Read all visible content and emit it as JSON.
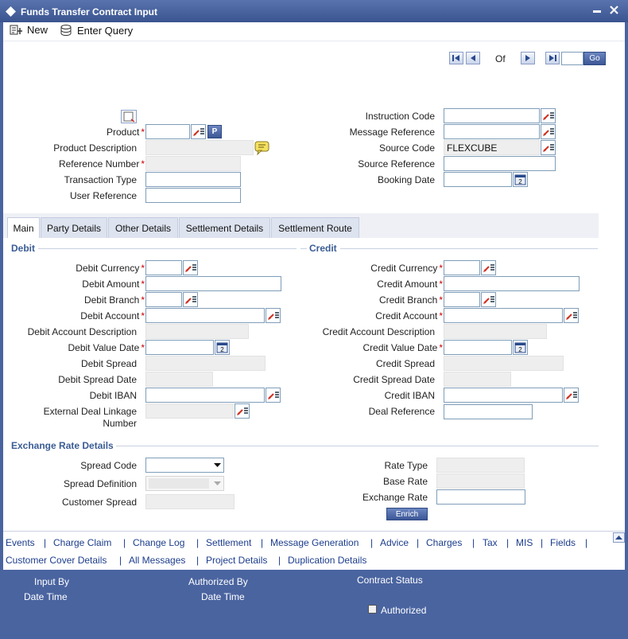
{
  "window": {
    "title": "Funds Transfer Contract Input"
  },
  "toolbar": {
    "new_label": "New",
    "enter_query_label": "Enter Query"
  },
  "pager": {
    "of_label": "Of",
    "go_label": "Go"
  },
  "header": {
    "product_label": "Product",
    "product_btn": "P",
    "product_description_label": "Product Description",
    "reference_number_label": "Reference Number",
    "transaction_type_label": "Transaction Type",
    "user_reference_label": "User Reference",
    "instruction_code_label": "Instruction Code",
    "message_reference_label": "Message Reference",
    "source_code_label": "Source Code",
    "source_code_value": "FLEXCUBE",
    "source_reference_label": "Source Reference",
    "booking_date_label": "Booking Date"
  },
  "tabs": [
    {
      "label": "Main"
    },
    {
      "label": "Party Details"
    },
    {
      "label": "Other Details"
    },
    {
      "label": "Settlement Details"
    },
    {
      "label": "Settlement Route"
    }
  ],
  "debit": {
    "section_label": "Debit",
    "currency_label": "Debit Currency",
    "amount_label": "Debit Amount",
    "branch_label": "Debit Branch",
    "account_label": "Debit Account",
    "account_description_label": "Debit Account Description",
    "value_date_label": "Debit Value Date",
    "spread_label": "Debit Spread",
    "spread_date_label": "Debit Spread Date",
    "iban_label": "Debit IBAN",
    "external_deal_label_1": "External Deal Linkage",
    "external_deal_label_2": "Number"
  },
  "credit": {
    "section_label": "Credit",
    "currency_label": "Credit Currency",
    "amount_label": "Credit Amount",
    "branch_label": "Credit Branch",
    "account_label": "Credit Account",
    "account_description_label": "Credit Account Description",
    "value_date_label": "Credit Value Date",
    "spread_label": "Credit Spread",
    "spread_date_label": "Credit Spread Date",
    "iban_label": "Credit IBAN",
    "deal_reference_label": "Deal Reference"
  },
  "exchange": {
    "section_label": "Exchange Rate Details",
    "spread_code_label": "Spread Code",
    "spread_definition_label": "Spread Definition",
    "customer_spread_label": "Customer Spread",
    "rate_type_label": "Rate Type",
    "base_rate_label": "Base Rate",
    "exchange_rate_label": "Exchange Rate",
    "enrich_label": "Enrich"
  },
  "links_row1": [
    "Events",
    "Charge Claim",
    "Change Log",
    "Settlement",
    "Message Generation",
    "Advice",
    "Charges",
    "Tax",
    "MIS",
    "Fields"
  ],
  "links_row2": [
    "Customer Cover Details",
    "All Messages",
    "Project Details",
    "Duplication Details"
  ],
  "footer": {
    "input_by_label": "Input By",
    "date_time_label": "Date Time",
    "authorized_by_label": "Authorized By",
    "date_time2_label": "Date Time",
    "contract_status_label": "Contract Status",
    "authorized_label": "Authorized"
  },
  "colors": {
    "titlebar": "#4a64a0",
    "required": "#cc0000",
    "link": "#1c3d8c",
    "section": "#3a5c94"
  }
}
